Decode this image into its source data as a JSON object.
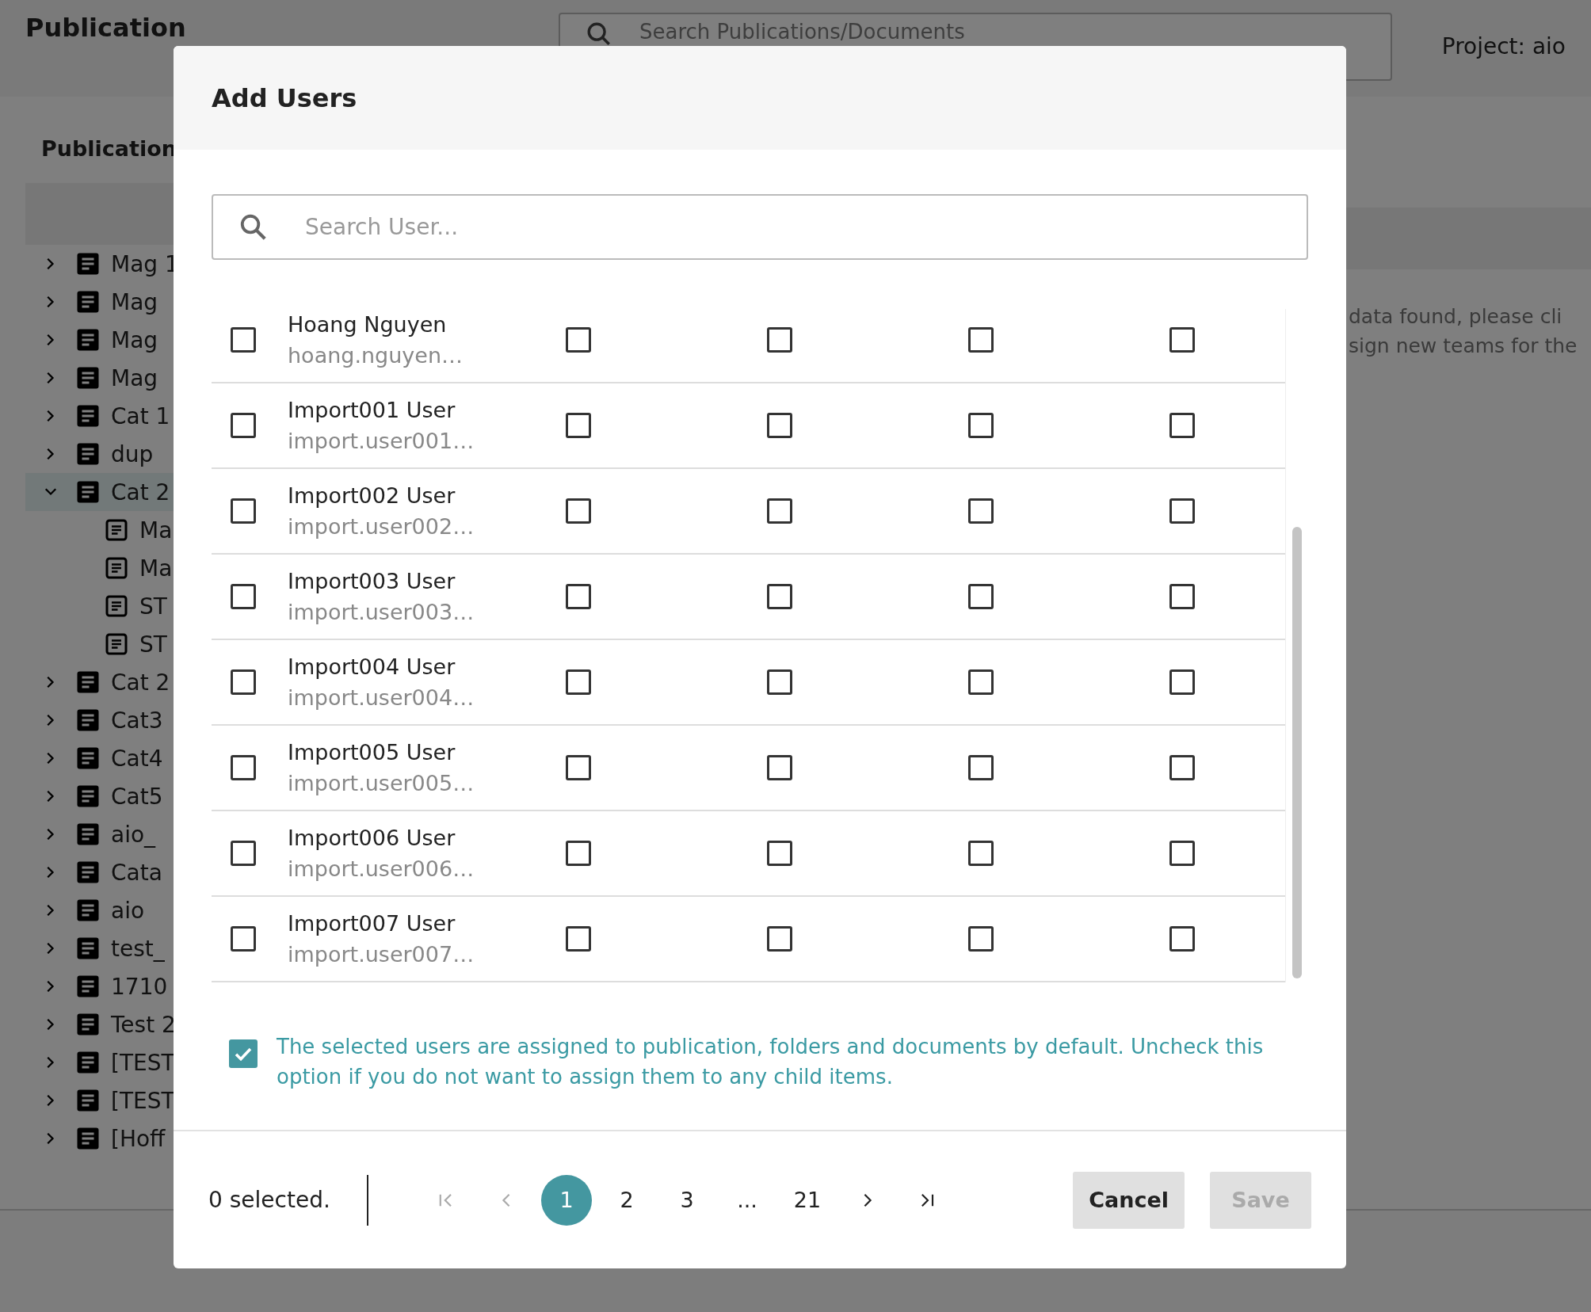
{
  "page": {
    "title": "Publication",
    "search": {
      "placeholder": "Search Publications/Documents"
    },
    "project": "Project: aio",
    "section_title": "Publication",
    "tree": [
      {
        "label": "Mag 1",
        "expanded": false
      },
      {
        "label": "Mag",
        "expanded": false
      },
      {
        "label": "Mag",
        "expanded": false
      },
      {
        "label": "Mag",
        "expanded": false
      },
      {
        "label": "Cat 1",
        "expanded": false
      },
      {
        "label": "dup",
        "expanded": false
      },
      {
        "label": "Cat 2",
        "expanded": true,
        "children": [
          {
            "label": "Ma"
          },
          {
            "label": "Ma"
          },
          {
            "label": "ST"
          },
          {
            "label": "ST"
          }
        ]
      },
      {
        "label": "Cat 2",
        "expanded": false
      },
      {
        "label": "Cat3",
        "expanded": false
      },
      {
        "label": "Cat4",
        "expanded": false
      },
      {
        "label": "Cat5",
        "expanded": false
      },
      {
        "label": "aio_",
        "expanded": false
      },
      {
        "label": "Cata",
        "expanded": false
      },
      {
        "label": "aio",
        "expanded": false
      },
      {
        "label": "test_",
        "expanded": false
      },
      {
        "label": "1710",
        "expanded": false
      },
      {
        "label": "Test 2",
        "expanded": false
      },
      {
        "label": "[TEST",
        "expanded": false
      },
      {
        "label": "[TEST",
        "expanded": false
      },
      {
        "label": "[Hoff",
        "expanded": false
      }
    ],
    "empty_message": [
      "data found, please cli",
      "sign new teams for the"
    ]
  },
  "dialog": {
    "title": "Add Users",
    "search": {
      "placeholder": "Search User..."
    },
    "users": [
      {
        "name": "Hoang Nguyen",
        "email": "hoang.nguyen…",
        "checked": false,
        "permissions": [
          false,
          false,
          false,
          false
        ]
      },
      {
        "name": "Import001 User",
        "email": "import.user001…",
        "checked": false,
        "permissions": [
          false,
          false,
          false,
          false
        ]
      },
      {
        "name": "Import002 User",
        "email": "import.user002…",
        "checked": false,
        "permissions": [
          false,
          false,
          false,
          false
        ]
      },
      {
        "name": "Import003 User",
        "email": "import.user003…",
        "checked": false,
        "permissions": [
          false,
          false,
          false,
          false
        ]
      },
      {
        "name": "Import004 User",
        "email": "import.user004…",
        "checked": false,
        "permissions": [
          false,
          false,
          false,
          false
        ]
      },
      {
        "name": "Import005 User",
        "email": "import.user005…",
        "checked": false,
        "permissions": [
          false,
          false,
          false,
          false
        ]
      },
      {
        "name": "Import006 User",
        "email": "import.user006…",
        "checked": false,
        "permissions": [
          false,
          false,
          false,
          false
        ]
      },
      {
        "name": "Import007 User",
        "email": "import.user007…",
        "checked": false,
        "permissions": [
          false,
          false,
          false,
          false
        ]
      }
    ],
    "assign_default": {
      "checked": true,
      "text": "The selected users are assigned to publication, folders and documents by default. Uncheck this option if you do not want to assign them to any child items."
    },
    "selected_count": "0 selected.",
    "pagination": {
      "first_disabled": true,
      "prev_disabled": true,
      "next_disabled": false,
      "last_disabled": false,
      "pages": [
        {
          "label": "1",
          "selected": true
        },
        {
          "label": "2",
          "selected": false
        },
        {
          "label": "3",
          "selected": false
        },
        {
          "label": "...",
          "selected": false
        },
        {
          "label": "21",
          "selected": false
        }
      ]
    },
    "buttons": [
      {
        "label": "Cancel",
        "disabled": false
      },
      {
        "label": "Save",
        "disabled": true
      }
    ]
  }
}
